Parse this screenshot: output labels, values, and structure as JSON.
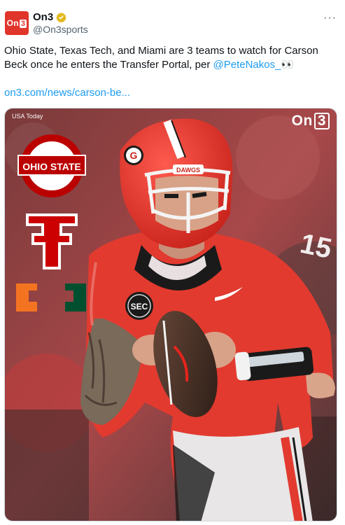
{
  "account": {
    "display_name": "On3",
    "handle": "@On3sports",
    "avatar_text": "On",
    "avatar_num": "3"
  },
  "tweet": {
    "text_main": "Ohio State, Texas Tech, and Miami are 3 teams to watch for Carson Beck once he enters the Transfer Portal, per ",
    "mention": "@PeteNakos_",
    "emoji": "👀",
    "link": "on3.com/news/carson-be..."
  },
  "media": {
    "credit": "USA Today",
    "brand_text": "On",
    "brand_num": "3",
    "logo_osu": "OHIO STATE",
    "logo_tt": "TT",
    "logo_um": "U",
    "helmet_text": "DAWGS",
    "patch_text": "SEC",
    "jersey_number": "15"
  },
  "colors": {
    "on3_red": "#e0352b",
    "link_blue": "#1d9bf0",
    "verified_gold": "#e2b719",
    "jersey_red": "#e23a2f"
  }
}
